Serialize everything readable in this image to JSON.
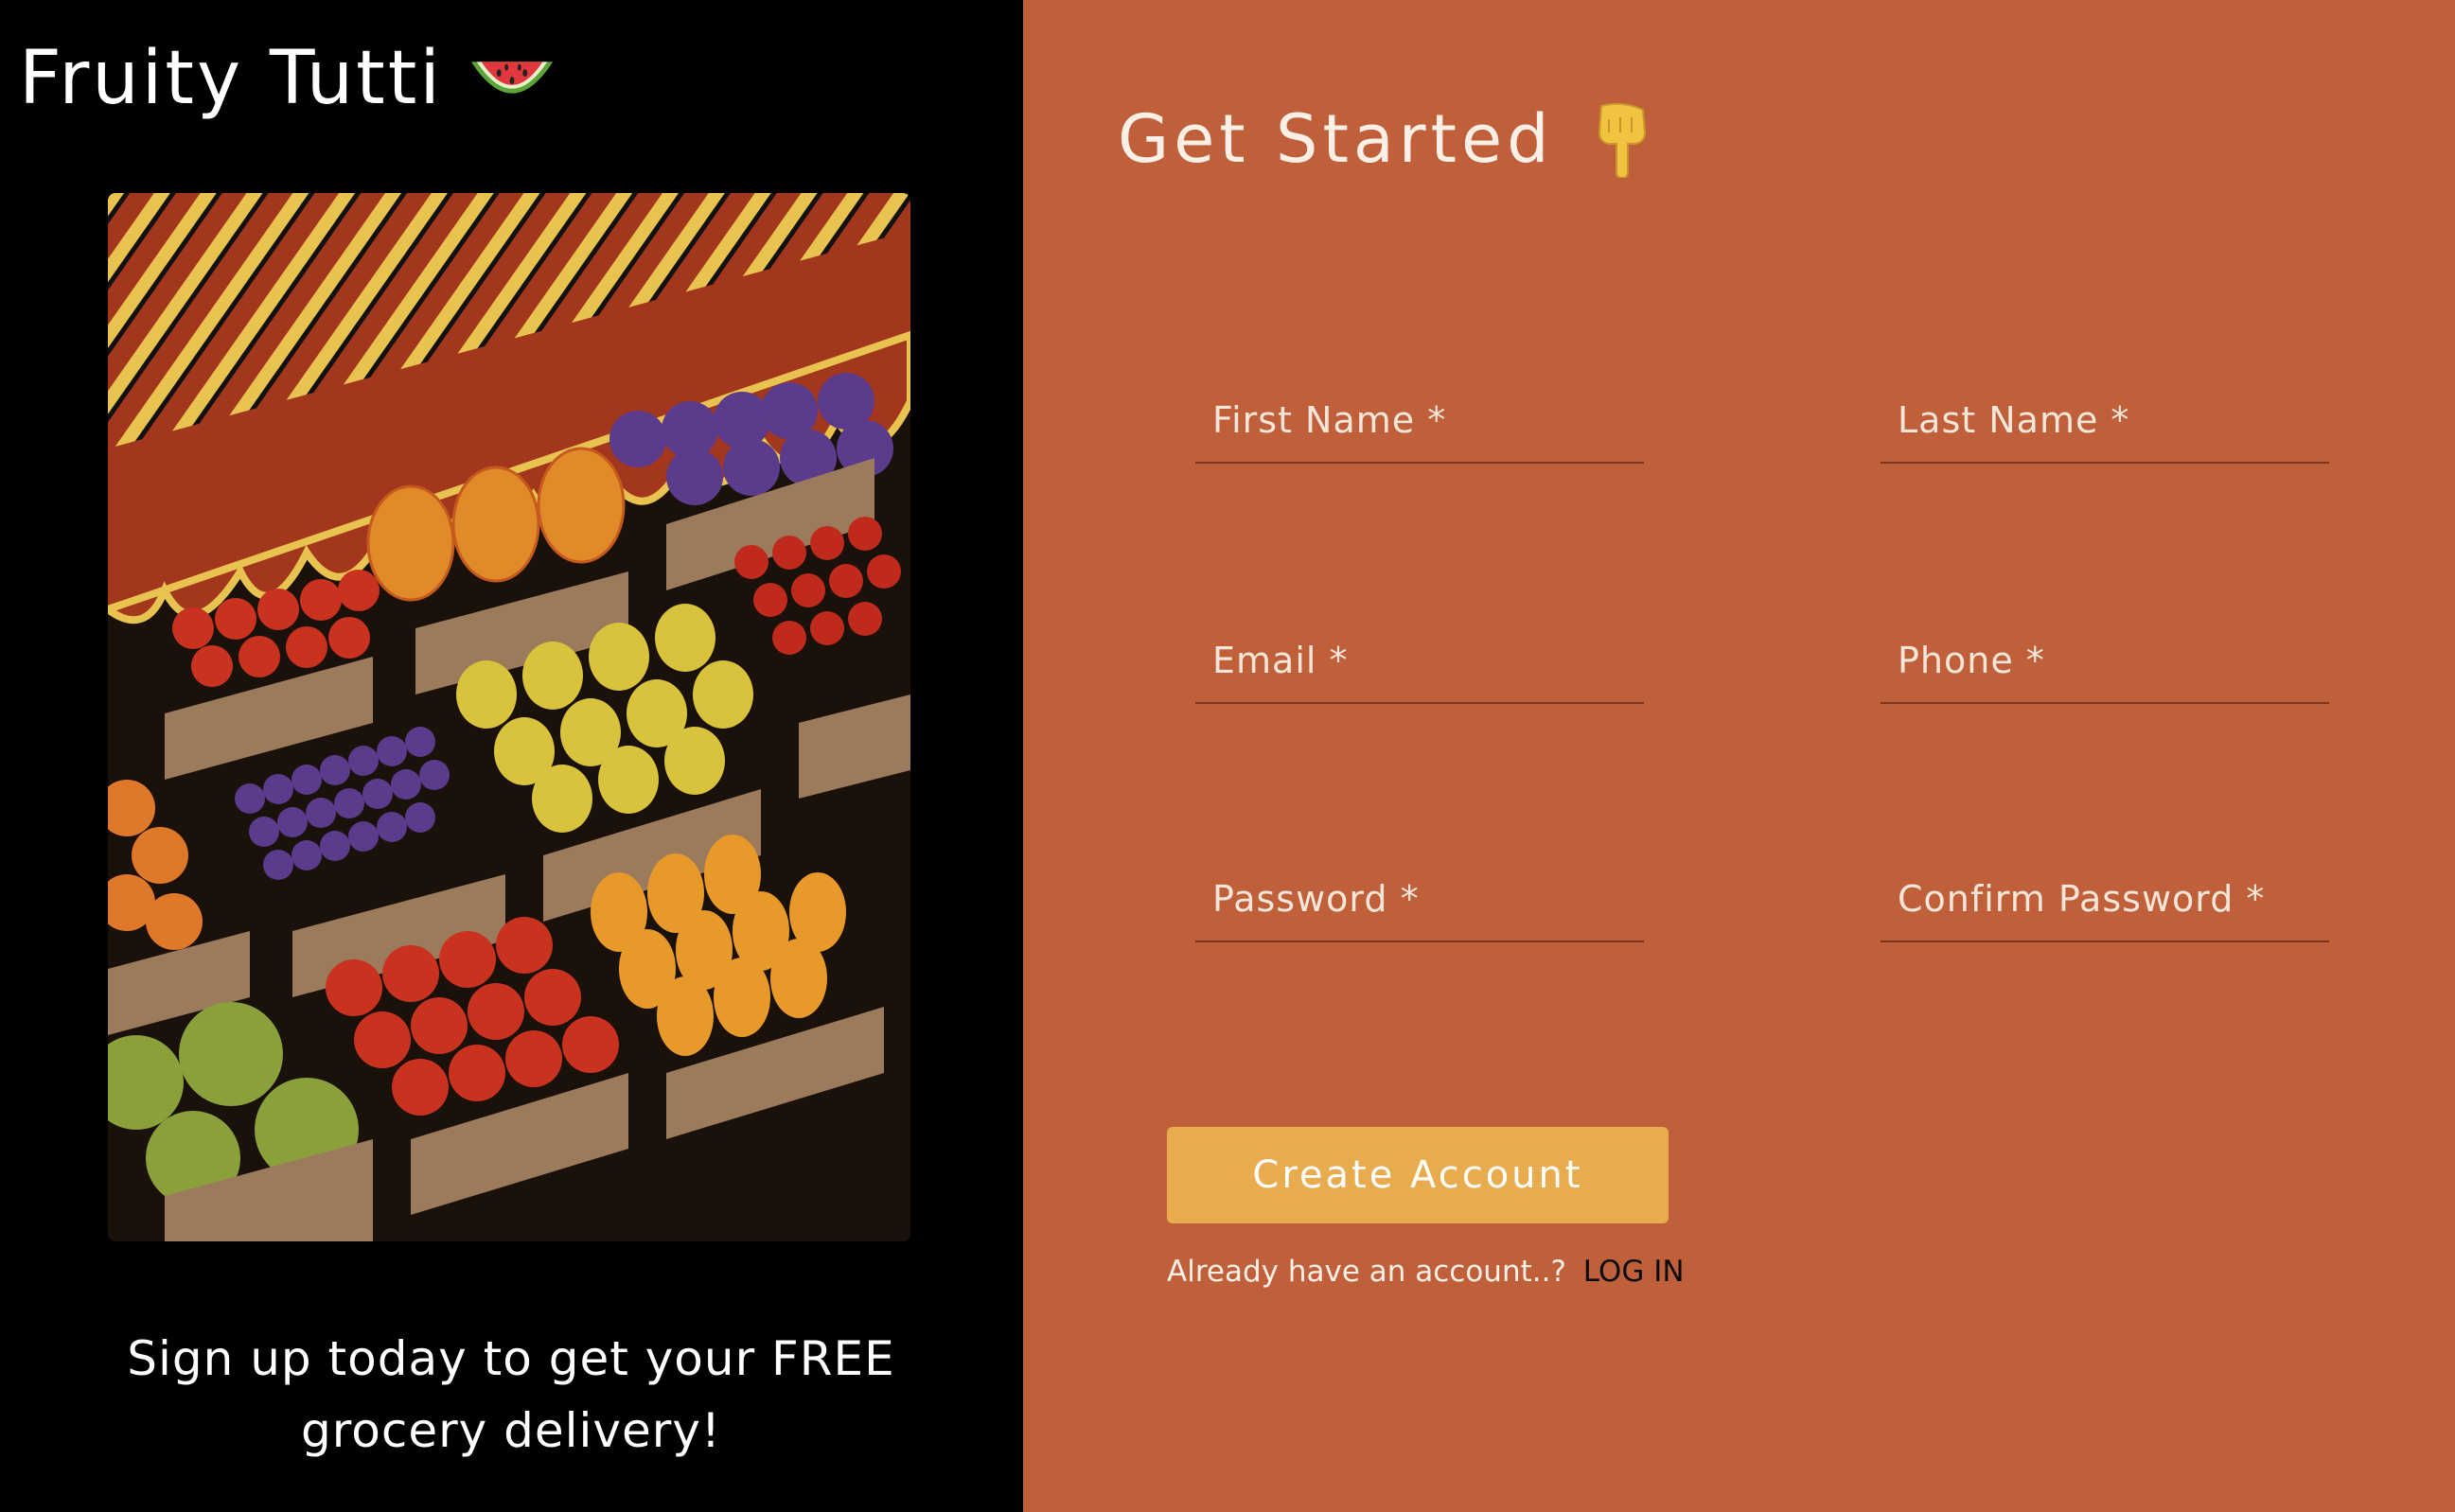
{
  "brand": {
    "name": "Fruity Tutti",
    "icon": "watermelon-icon"
  },
  "hero": {
    "illustration": "fruit-market-stall-illustration",
    "tagline": "Sign up today to get your FREE grocery delivery!"
  },
  "form": {
    "heading": "Get Started",
    "heading_icon": "pointing-down-hand-icon",
    "fields": {
      "first_name": {
        "label": "First Name *",
        "value": ""
      },
      "last_name": {
        "label": "Last Name *",
        "value": ""
      },
      "email": {
        "label": "Email *",
        "value": ""
      },
      "phone": {
        "label": "Phone *",
        "value": ""
      },
      "password": {
        "label": "Password *",
        "value": ""
      },
      "confirm_password": {
        "label": "Confirm Password *",
        "value": ""
      }
    },
    "submit_label": "Create Account",
    "login_prompt": "Already have an account..?",
    "login_link": "LOG IN"
  },
  "colors": {
    "left_bg": "#000000",
    "right_bg": "#c0603a",
    "button": "#e8ac4f",
    "awning_red": "#a3371d",
    "awning_yellow": "#e9c34f"
  }
}
